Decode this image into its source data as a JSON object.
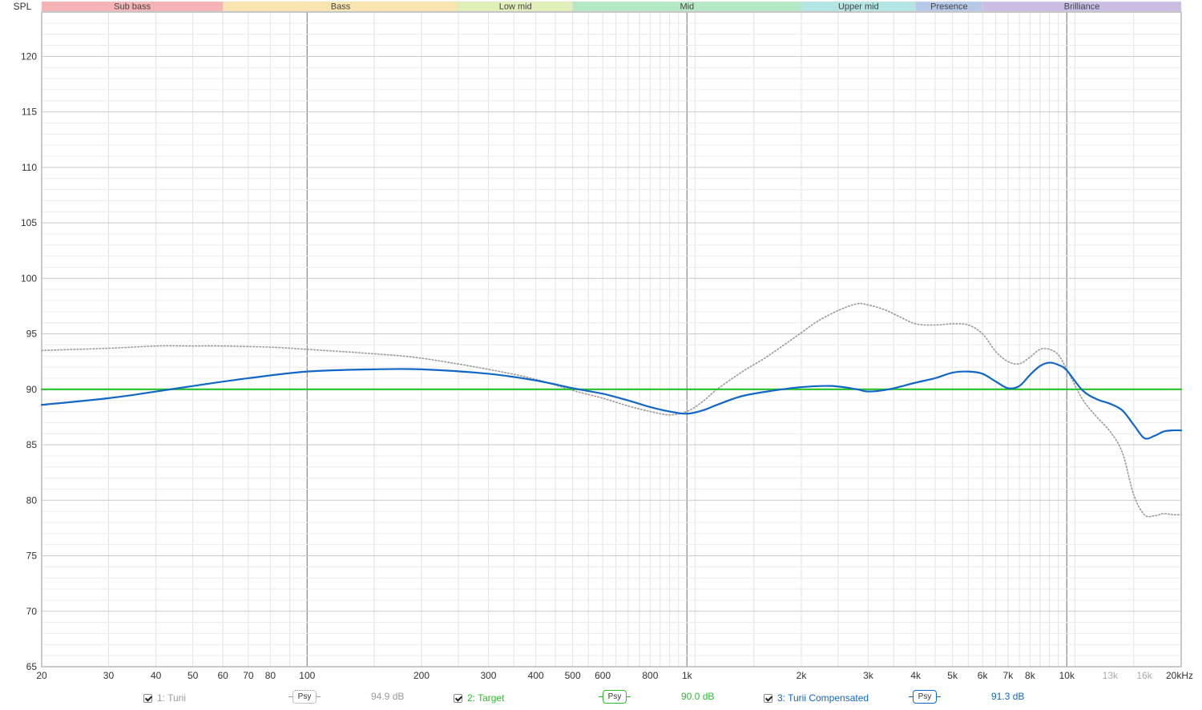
{
  "chart_data": {
    "type": "line",
    "y_axis_title": "SPL",
    "xscale": "log",
    "xlim": [
      20,
      20000
    ],
    "ylim": [
      65,
      124
    ],
    "yticks": [
      65,
      70,
      75,
      80,
      85,
      90,
      95,
      100,
      105,
      110,
      115,
      120
    ],
    "x_major_ticks": [
      {
        "v": 20,
        "label": "20"
      },
      {
        "v": 30,
        "label": "30"
      },
      {
        "v": 40,
        "label": "40"
      },
      {
        "v": 50,
        "label": "50"
      },
      {
        "v": 60,
        "label": "60"
      },
      {
        "v": 70,
        "label": "70"
      },
      {
        "v": 80,
        "label": "80"
      },
      {
        "v": 100,
        "label": "100"
      },
      {
        "v": 200,
        "label": "200"
      },
      {
        "v": 300,
        "label": "300"
      },
      {
        "v": 400,
        "label": "400"
      },
      {
        "v": 500,
        "label": "500"
      },
      {
        "v": 600,
        "label": "600"
      },
      {
        "v": 800,
        "label": "800"
      },
      {
        "v": 1000,
        "label": "1k"
      },
      {
        "v": 2000,
        "label": "2k"
      },
      {
        "v": 3000,
        "label": "3k"
      },
      {
        "v": 4000,
        "label": "4k"
      },
      {
        "v": 5000,
        "label": "5k"
      },
      {
        "v": 6000,
        "label": "6k"
      },
      {
        "v": 7000,
        "label": "7k"
      },
      {
        "v": 8000,
        "label": "8k"
      },
      {
        "v": 10000,
        "label": "10k"
      },
      {
        "v": 13000,
        "label": "13k",
        "dim": true
      },
      {
        "v": 16000,
        "label": "16k",
        "dim": true
      },
      {
        "v": 20000,
        "label": "20kHz"
      }
    ],
    "bands": [
      {
        "name": "Sub bass",
        "from": 20,
        "to": 60,
        "color": "#f5b3b5"
      },
      {
        "name": "Bass",
        "from": 60,
        "to": 250,
        "color": "#fae5b0"
      },
      {
        "name": "Low mid",
        "from": 250,
        "to": 500,
        "color": "#e0f0b8"
      },
      {
        "name": "Mid",
        "from": 500,
        "to": 2000,
        "color": "#b5e8c5"
      },
      {
        "name": "Upper mid",
        "from": 2000,
        "to": 4000,
        "color": "#b5e5e2"
      },
      {
        "name": "Presence",
        "from": 4000,
        "to": 6000,
        "color": "#b5c8e8"
      },
      {
        "name": "Brilliance",
        "from": 6000,
        "to": 20000,
        "color": "#c9bde3"
      }
    ],
    "series": [
      {
        "name": "1: Turii",
        "color": "#9a9a9a",
        "style": "dotted",
        "points": [
          [
            20,
            93.5
          ],
          [
            30,
            93.7
          ],
          [
            40,
            93.9
          ],
          [
            50,
            93.9
          ],
          [
            60,
            93.9
          ],
          [
            80,
            93.8
          ],
          [
            100,
            93.6
          ],
          [
            150,
            93.2
          ],
          [
            200,
            92.8
          ],
          [
            300,
            91.8
          ],
          [
            400,
            90.9
          ],
          [
            500,
            89.9
          ],
          [
            600,
            89.2
          ],
          [
            700,
            88.5
          ],
          [
            800,
            88.0
          ],
          [
            900,
            87.7
          ],
          [
            1000,
            88.0
          ],
          [
            1100,
            88.9
          ],
          [
            1200,
            90.0
          ],
          [
            1400,
            91.6
          ],
          [
            1600,
            92.8
          ],
          [
            1800,
            94.0
          ],
          [
            2000,
            95.1
          ],
          [
            2200,
            96.1
          ],
          [
            2500,
            97.1
          ],
          [
            2800,
            97.7
          ],
          [
            3000,
            97.6
          ],
          [
            3300,
            97.2
          ],
          [
            3600,
            96.6
          ],
          [
            4000,
            95.9
          ],
          [
            4500,
            95.8
          ],
          [
            5000,
            95.9
          ],
          [
            5500,
            95.8
          ],
          [
            6000,
            95.0
          ],
          [
            6500,
            93.4
          ],
          [
            7000,
            92.5
          ],
          [
            7500,
            92.3
          ],
          [
            8000,
            92.9
          ],
          [
            8500,
            93.6
          ],
          [
            9000,
            93.6
          ],
          [
            9500,
            93.1
          ],
          [
            10000,
            91.8
          ],
          [
            11000,
            89.1
          ],
          [
            12000,
            87.5
          ],
          [
            13000,
            86.2
          ],
          [
            14000,
            84.3
          ],
          [
            15000,
            80.5
          ],
          [
            16000,
            78.7
          ],
          [
            17000,
            78.6
          ],
          [
            18000,
            78.8
          ],
          [
            19000,
            78.7
          ],
          [
            20000,
            78.7
          ]
        ]
      },
      {
        "name": "2: Target",
        "color": "#29c02a",
        "style": "solid",
        "points": [
          [
            20,
            90.0
          ],
          [
            20000,
            90.0
          ]
        ]
      },
      {
        "name": "3: Turii Compensated",
        "color": "#1167c5",
        "style": "solid",
        "points": [
          [
            20,
            88.6
          ],
          [
            30,
            89.2
          ],
          [
            40,
            89.8
          ],
          [
            50,
            90.3
          ],
          [
            70,
            91.0
          ],
          [
            100,
            91.6
          ],
          [
            150,
            91.8
          ],
          [
            200,
            91.8
          ],
          [
            300,
            91.4
          ],
          [
            400,
            90.8
          ],
          [
            500,
            90.1
          ],
          [
            600,
            89.6
          ],
          [
            700,
            89.0
          ],
          [
            800,
            88.4
          ],
          [
            900,
            88.0
          ],
          [
            1000,
            87.8
          ],
          [
            1100,
            88.1
          ],
          [
            1200,
            88.6
          ],
          [
            1400,
            89.4
          ],
          [
            1700,
            89.9
          ],
          [
            2000,
            90.2
          ],
          [
            2400,
            90.3
          ],
          [
            2800,
            90.0
          ],
          [
            3000,
            89.8
          ],
          [
            3400,
            90.0
          ],
          [
            4000,
            90.6
          ],
          [
            4500,
            91.0
          ],
          [
            5000,
            91.5
          ],
          [
            5500,
            91.6
          ],
          [
            6000,
            91.4
          ],
          [
            6500,
            90.7
          ],
          [
            7000,
            90.1
          ],
          [
            7500,
            90.3
          ],
          [
            8000,
            91.3
          ],
          [
            8500,
            92.1
          ],
          [
            9000,
            92.4
          ],
          [
            9500,
            92.2
          ],
          [
            10000,
            91.7
          ],
          [
            11000,
            89.9
          ],
          [
            12000,
            89.1
          ],
          [
            13000,
            88.7
          ],
          [
            14000,
            88.1
          ],
          [
            15000,
            86.8
          ],
          [
            16000,
            85.6
          ],
          [
            17000,
            85.8
          ],
          [
            18000,
            86.2
          ],
          [
            19000,
            86.3
          ],
          [
            20000,
            86.3
          ]
        ]
      }
    ]
  },
  "legend": [
    {
      "label": "1: Turii",
      "psy": "Psy",
      "db": "94.9 dB",
      "color": "#9a9a9a",
      "psy_border": "dotted"
    },
    {
      "label": "2: Target",
      "psy": "Psy",
      "db": "90.0 dB",
      "color": "#29c02a",
      "psy_border": "solid"
    },
    {
      "label": "3: Turii Compensated",
      "psy": "Psy",
      "db": "91.3 dB",
      "color": "#1167c5",
      "psy_border": "solid"
    }
  ]
}
